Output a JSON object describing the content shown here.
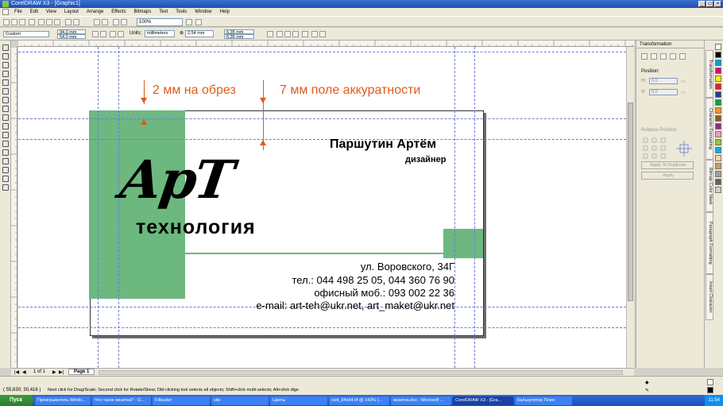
{
  "window": {
    "title": "CorelDRAW X3 - [Graphic1]"
  },
  "menu": [
    "File",
    "Edit",
    "View",
    "Layout",
    "Arrange",
    "Effects",
    "Bitmaps",
    "Text",
    "Tools",
    "Window",
    "Help"
  ],
  "toolbar": {
    "zoom": "100%"
  },
  "propbar": {
    "preset": "Custom",
    "width": "94,0 mm",
    "height": "54,0 mm",
    "units_label": "Units:",
    "units": "millimeters",
    "nudge": "2,54 mm",
    "dup_x": "6,35 mm",
    "dup_y": "6,35 mm"
  },
  "annotations": {
    "bleed": "2 мм на обрез",
    "safe": "7 мм поле аккуратности"
  },
  "card": {
    "name": "Паршутин Артём",
    "role": "дизайнер",
    "logo_main": "АрТ",
    "logo_sub": "технология",
    "address": "ул. Воровского, 34Г",
    "phones": "тел.: 044 498 25 05, 044 360 76 90",
    "mobile": "офисный моб.: 093 002 22 36",
    "email": "e-mail: art-teh@ukr.net, art_maket@ukr.net"
  },
  "docker": {
    "title": "Transformation",
    "position_label": "Position:",
    "h_val": "0,0",
    "v_val": "0,0",
    "relative": "Relative Position",
    "apply_dup": "Apply To Duplicate",
    "apply": "Apply"
  },
  "docker_tabs": [
    "Transformation",
    "Character Formatting",
    "Bitmap Color Mask",
    "Paragraph Formatting",
    "Insert Character"
  ],
  "pagebar": {
    "counter": "1 of 1",
    "page_tab": "Page 1"
  },
  "status": {
    "coords": "( 55,630; 30,416 )",
    "hint": "Next click for Drag/Scale; Second click for Rotate/Skew; Dbl-clicking tool selects all objects; Shift+click multi-selects; Alt+click digs"
  },
  "taskbar": {
    "start": "Пуск",
    "tasks": [
      "Проигрыватель Windo...",
      "Что такое визитка? - O...",
      "Filbuster",
      "site",
      "Цветы",
      "vizit_94x54.tif @ 142% (...",
      "визитка.doc - Microsoft ...",
      "CorelDRAW X3 - [Gra...",
      "Калькулятор Плюс"
    ],
    "clock": "11:54"
  },
  "colors": {
    "green": "#6db87f",
    "orange": "#e05a1a",
    "guide": "#6b78d6"
  },
  "icons": [
    "pick-tool-icon",
    "shape-tool-icon",
    "zoom-tool-icon",
    "freehand-tool-icon",
    "rectangle-tool-icon",
    "ellipse-tool-icon",
    "polygon-tool-icon",
    "text-tool-icon",
    "fill-tool-icon",
    "outline-tool-icon"
  ]
}
